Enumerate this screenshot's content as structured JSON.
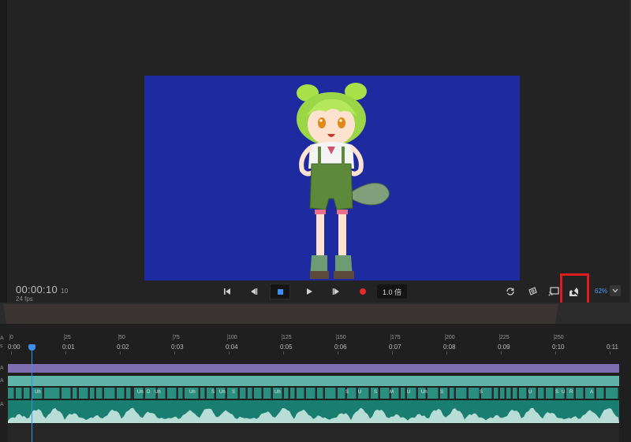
{
  "player": {
    "timecode": "00:00:10",
    "timecode_frames": "10",
    "fps": "24 fps",
    "speed": "1.0 倍",
    "zoom": "62%"
  },
  "icons": {
    "skip_start": "skip-to-start-icon",
    "step_back": "step-back-icon",
    "stop": "stop-icon",
    "play": "play-icon",
    "step_forward": "step-forward-icon",
    "record": "record-icon",
    "loop": "loop-icon",
    "camera": "camera-icon",
    "cast": "cast-icon",
    "puppet": "puppet-icon",
    "dropdown": "chevron-down-icon"
  },
  "colors": {
    "stage_bg": "#1e2a9f",
    "accent": "#3b8ff0",
    "record": "#e11b1b",
    "highlight": "#e11b1b"
  },
  "timeline": {
    "side_labels": [
      "A",
      "s",
      "A",
      "A",
      "A"
    ],
    "frame_labels": [
      "0",
      "25",
      "50",
      "75",
      "100",
      "125",
      "150",
      "175",
      "200",
      "225",
      "250"
    ],
    "time_labels": [
      "0:00",
      "0:01",
      "0:02",
      "0:03",
      "0:04",
      "0:05",
      "0:06",
      "0:07",
      "0:08",
      "0:09",
      "0:10",
      "0:11"
    ],
    "viseme_labels": [
      "Uh",
      "Uh",
      "D",
      "Uh",
      "Uh",
      "S",
      "Uh",
      "S",
      "Uh",
      "S",
      "U",
      "S",
      "M",
      "U",
      "Uh",
      "S",
      "S",
      "U",
      "S",
      "U",
      "R",
      "A"
    ]
  }
}
